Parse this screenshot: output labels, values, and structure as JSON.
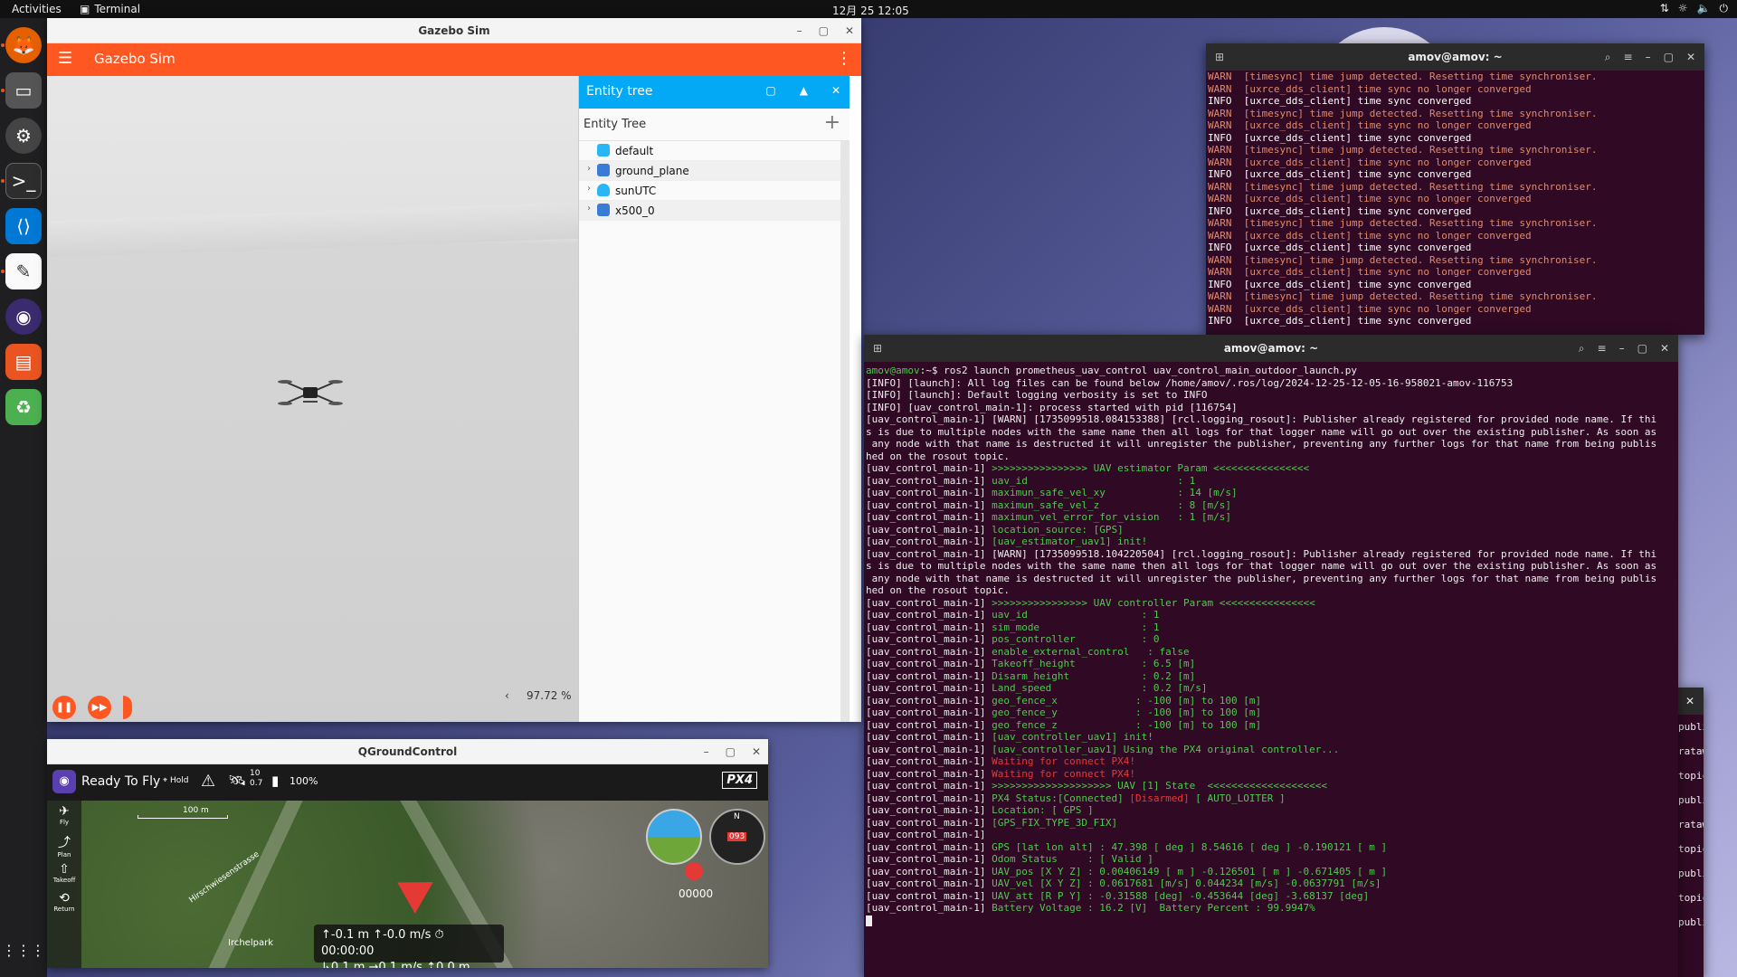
{
  "topbar": {
    "activities": "Activities",
    "app_name": "Terminal",
    "clock": "12月 25  12:05"
  },
  "dock": {
    "items": [
      "firefox-icon",
      "files-icon",
      "settings-icon",
      "terminal-icon",
      "vscode-icon",
      "text-editor-icon",
      "qgroundcontrol-icon",
      "software-icon",
      "trash-icon"
    ],
    "apps_grid": "⋮⋮⋮"
  },
  "gazebo": {
    "window_title": "Gazebo Sim",
    "app_title": "Gazebo Sim",
    "zoom": "97.72 %",
    "entity_panel_title": "Entity tree",
    "entity_tree_label": "Entity Tree",
    "entities": [
      {
        "name": "default",
        "color": "#29b6f6",
        "expandable": false
      },
      {
        "name": "ground_plane",
        "color": "#3a7bd5",
        "expandable": true
      },
      {
        "name": "sunUTC",
        "color": "#29b6f6",
        "expandable": true
      },
      {
        "name": "x500_0",
        "color": "#3a7bd5",
        "expandable": true
      }
    ]
  },
  "qgc": {
    "window_title": "QGroundControl",
    "status": "Ready To Fly",
    "mode": "Hold",
    "sats": "10",
    "hdop": "0.7",
    "battery": "100%",
    "scale": "100 m",
    "brand": "PX4",
    "leftbar": [
      "Fly",
      "Plan",
      "Takeoff",
      "Return"
    ],
    "telemetry_line1": "↑-0.1 m  ↑-0.0 m/s  ⏱00:00:00",
    "telemetry_line2": "↳0.1 m   →0.1 m/s  ⇡0.0 m",
    "place_label": "Irchelpark",
    "street_label": "Hirschwiesenstrasse",
    "heading": "093",
    "counter": "00000"
  },
  "terminal_top": {
    "title": "amov@amov: ~",
    "lines": [
      [
        "warn",
        "WARN  [timesync] time jump detected. Resetting time synchroniser."
      ],
      [
        "warn",
        "WARN  [uxrce_dds_client] time sync no longer converged"
      ],
      [
        "info",
        "INFO  [uxrce_dds_client] time sync converged"
      ],
      [
        "warn",
        "WARN  [timesync] time jump detected. Resetting time synchroniser."
      ],
      [
        "warn",
        "WARN  [uxrce_dds_client] time sync no longer converged"
      ],
      [
        "info",
        "INFO  [uxrce_dds_client] time sync converged"
      ],
      [
        "warn",
        "WARN  [timesync] time jump detected. Resetting time synchroniser."
      ],
      [
        "warn",
        "WARN  [uxrce_dds_client] time sync no longer converged"
      ],
      [
        "info",
        "INFO  [uxrce_dds_client] time sync converged"
      ],
      [
        "warn",
        "WARN  [timesync] time jump detected. Resetting time synchroniser."
      ],
      [
        "warn",
        "WARN  [uxrce_dds_client] time sync no longer converged"
      ],
      [
        "info",
        "INFO  [uxrce_dds_client] time sync converged"
      ],
      [
        "warn",
        "WARN  [timesync] time jump detected. Resetting time synchroniser."
      ],
      [
        "warn",
        "WARN  [uxrce_dds_client] time sync no longer converged"
      ],
      [
        "info",
        "INFO  [uxrce_dds_client] time sync converged"
      ],
      [
        "warn",
        "WARN  [timesync] time jump detected. Resetting time synchroniser."
      ],
      [
        "warn",
        "WARN  [uxrce_dds_client] time sync no longer converged"
      ],
      [
        "info",
        "INFO  [uxrce_dds_client] time sync converged"
      ],
      [
        "warn",
        "WARN  [timesync] time jump detected. Resetting time synchroniser."
      ],
      [
        "warn",
        "WARN  [uxrce_dds_client] time sync no longer converged"
      ],
      [
        "info",
        "INFO  [uxrce_dds_client] time sync converged"
      ]
    ]
  },
  "terminal_main": {
    "title": "amov@amov: ~",
    "lines": [
      [
        [
          "g",
          "amov@amov"
        ],
        [
          "w",
          ":~$ ros2 launch prometheus_uav_control uav_control_main_outdoor_launch.py"
        ]
      ],
      [
        [
          "w",
          "[INFO] [launch]: All log files can be found below /home/amov/.ros/log/2024-12-25-12-05-16-958021-amov-116753"
        ]
      ],
      [
        [
          "w",
          "[INFO] [launch]: Default logging verbosity is set to INFO"
        ]
      ],
      [
        [
          "w",
          "[INFO] [uav_control_main-1]: process started with pid [116754]"
        ]
      ],
      [
        [
          "w",
          "[uav_control_main-1] [WARN] [1735099518.084153388] [rcl.logging_rosout]: Publisher already registered for provided node name. If thi"
        ]
      ],
      [
        [
          "w",
          "s is due to multiple nodes with the same name then all logs for that logger name will go out over the existing publisher. As soon as"
        ]
      ],
      [
        [
          "w",
          " any node with that name is destructed it will unregister the publisher, preventing any further logs for that name from being publis"
        ]
      ],
      [
        [
          "w",
          "hed on the rosout topic."
        ]
      ],
      [
        [
          "w",
          "[uav_control_main-1] "
        ],
        [
          "g",
          ">>>>>>>>>>>>>>>> UAV estimator Param <<<<<<<<<<<<<<<<"
        ]
      ],
      [
        [
          "w",
          "[uav_control_main-1] "
        ],
        [
          "g",
          "uav_id                         : 1"
        ]
      ],
      [
        [
          "w",
          "[uav_control_main-1] "
        ],
        [
          "g",
          "maximun_safe_vel_xy            : 14 [m/s]"
        ]
      ],
      [
        [
          "w",
          "[uav_control_main-1] "
        ],
        [
          "g",
          "maximun_safe_vel_z             : 8 [m/s]"
        ]
      ],
      [
        [
          "w",
          "[uav_control_main-1] "
        ],
        [
          "g",
          "maximun_vel_error_for_vision   : 1 [m/s]"
        ]
      ],
      [
        [
          "w",
          "[uav_control_main-1] "
        ],
        [
          "g",
          "location_source: [GPS]"
        ]
      ],
      [
        [
          "w",
          "[uav_control_main-1] "
        ],
        [
          "g",
          "[uav_estimator_uav1] init!"
        ]
      ],
      [
        [
          "w",
          "[uav_control_main-1] [WARN] [1735099518.104220504] [rcl.logging_rosout]: Publisher already registered for provided node name. If thi"
        ]
      ],
      [
        [
          "w",
          "s is due to multiple nodes with the same name then all logs for that logger name will go out over the existing publisher. As soon as"
        ]
      ],
      [
        [
          "w",
          " any node with that name is destructed it will unregister the publisher, preventing any further logs for that name from being publis"
        ]
      ],
      [
        [
          "w",
          "hed on the rosout topic."
        ]
      ],
      [
        [
          "w",
          "[uav_control_main-1] "
        ],
        [
          "g",
          ">>>>>>>>>>>>>>>> UAV controller Param <<<<<<<<<<<<<<<<"
        ]
      ],
      [
        [
          "w",
          "[uav_control_main-1] "
        ],
        [
          "g",
          "uav_id                   : 1"
        ]
      ],
      [
        [
          "w",
          "[uav_control_main-1] "
        ],
        [
          "g",
          "sim_mode                 : 1"
        ]
      ],
      [
        [
          "w",
          "[uav_control_main-1] "
        ],
        [
          "g",
          "pos_controller           : 0"
        ]
      ],
      [
        [
          "w",
          "[uav_control_main-1] "
        ],
        [
          "g",
          "enable_external_control   : false"
        ]
      ],
      [
        [
          "w",
          "[uav_control_main-1] "
        ],
        [
          "g",
          "Takeoff_height           : 6.5 [m]"
        ]
      ],
      [
        [
          "w",
          "[uav_control_main-1] "
        ],
        [
          "g",
          "Disarm_height            : 0.2 [m]"
        ]
      ],
      [
        [
          "w",
          "[uav_control_main-1] "
        ],
        [
          "g",
          "Land_speed               : 0.2 [m/s]"
        ]
      ],
      [
        [
          "w",
          "[uav_control_main-1] "
        ],
        [
          "g",
          "geo_fence_x             : -100 [m] to 100 [m]"
        ]
      ],
      [
        [
          "w",
          "[uav_control_main-1] "
        ],
        [
          "g",
          "geo_fence_y             : -100 [m] to 100 [m]"
        ]
      ],
      [
        [
          "w",
          "[uav_control_main-1] "
        ],
        [
          "g",
          "geo_fence_z             : -100 [m] to 100 [m]"
        ]
      ],
      [
        [
          "w",
          "[uav_control_main-1] "
        ],
        [
          "g",
          "[uav_controller_uav1] init!"
        ]
      ],
      [
        [
          "w",
          "[uav_control_main-1] "
        ],
        [
          "g",
          "[uav_controller_uav1] Using the PX4 original controller..."
        ]
      ],
      [
        [
          "w",
          "[uav_control_main-1] "
        ],
        [
          "r",
          "Waiting for connect PX4!"
        ]
      ],
      [
        [
          "w",
          "[uav_control_main-1] "
        ],
        [
          "r",
          "Waiting for connect PX4!"
        ]
      ],
      [
        [
          "w",
          "[uav_control_main-1] "
        ],
        [
          "g",
          ">>>>>>>>>>>>>>>>>>>> UAV [1] State  <<<<<<<<<<<<<<<<<<<<"
        ]
      ],
      [
        [
          "w",
          "[uav_control_main-1] "
        ],
        [
          "g",
          "PX4 Status:[Connected] "
        ],
        [
          "r",
          "[Disarmed]"
        ],
        [
          "g",
          " [ AUTO_LOITER ]"
        ]
      ],
      [
        [
          "w",
          "[uav_control_main-1] "
        ],
        [
          "g",
          "Location: [ GPS ]"
        ]
      ],
      [
        [
          "w",
          "[uav_control_main-1] "
        ],
        [
          "g",
          "[GPS_FIX_TYPE_3D_FIX]"
        ]
      ],
      [
        [
          "w",
          "[uav_control_main-1] "
        ]
      ],
      [
        [
          "w",
          "[uav_control_main-1] "
        ],
        [
          "g",
          "GPS [lat lon alt] : 47.398 [ deg ] 8.54616 [ deg ] -0.190121 [ m ]"
        ]
      ],
      [
        [
          "w",
          "[uav_control_main-1] "
        ],
        [
          "g",
          "Odom Status     : [ Valid ]"
        ]
      ],
      [
        [
          "w",
          "[uav_control_main-1] "
        ],
        [
          "g",
          "UAV_pos [X Y Z] : 0.00406149 [ m ] -0.126501 [ m ] -0.671405 [ m ]"
        ]
      ],
      [
        [
          "w",
          "[uav_control_main-1] "
        ],
        [
          "g",
          "UAV_vel [X Y Z] : 0.0617681 [m/s] 0.044234 [m/s] -0.0637791 [m/s]"
        ]
      ],
      [
        [
          "w",
          "[uav_control_main-1] "
        ],
        [
          "g",
          "UAV_att [R P Y] : -0.31588 [deg] -0.453644 [deg] -3.68137 [deg]"
        ]
      ],
      [
        [
          "w",
          "[uav_control_main-1] "
        ],
        [
          "g",
          "Battery Voltage : 16.2 [V]  Battery Percent : 99.9947%"
        ]
      ]
    ]
  },
  "terminal_side": {
    "lines": [
      "publi",
      "rataw",
      "topic",
      "publi",
      "rataw",
      "topic",
      "publi",
      "topic",
      "publi"
    ]
  }
}
